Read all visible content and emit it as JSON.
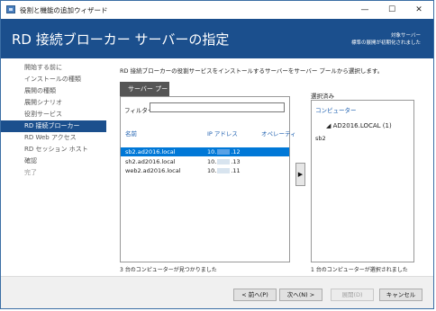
{
  "window": {
    "title": "役割と機能の追加ウィザード",
    "controls": {
      "minimize": "—",
      "maximize": "☐",
      "close": "✕"
    }
  },
  "header": {
    "title": "RD 接続ブローカー サーバーの指定",
    "destination_label": "対象サーバー",
    "destination_value": "標準の展開が初期化されました"
  },
  "nav": {
    "items": [
      {
        "label": "開始する前に",
        "state": "done"
      },
      {
        "label": "インストールの種類",
        "state": "done"
      },
      {
        "label": "展開の種類",
        "state": "done"
      },
      {
        "label": "展開シナリオ",
        "state": "done"
      },
      {
        "label": "役割サービス",
        "state": "done"
      },
      {
        "label": "RD 接続ブローカー",
        "state": "active"
      },
      {
        "label": "RD Web アクセス",
        "state": "done"
      },
      {
        "label": "RD セッション ホスト",
        "state": "done"
      },
      {
        "label": "確認",
        "state": "done"
      },
      {
        "label": "完了",
        "state": "future"
      }
    ]
  },
  "main": {
    "description": "RD 接続ブローカーの役割サービスをインストールするサーバーをサーバー プールから選択します。",
    "pool_tab": "サーバー プール",
    "filter_label": "フィルター:",
    "filter_value": "",
    "columns": {
      "name": "名前",
      "ip": "IP アドレス",
      "os": "オペレーティ"
    },
    "servers": [
      {
        "name": "sb2.ad2016.local",
        "ip_prefix": "10.",
        "ip_suffix": ".12",
        "selected": true
      },
      {
        "name": "sh2.ad2016.local",
        "ip_prefix": "10.",
        "ip_suffix": ".13",
        "selected": false
      },
      {
        "name": "web2.ad2016.local",
        "ip_prefix": "10.",
        "ip_suffix": ".11",
        "selected": false
      }
    ],
    "found_count": "3 台のコンピューターが見つかりました",
    "add_button": "▶",
    "selected_label": "選択済み",
    "selected_header": "コンピューター",
    "selected_group": "AD2016.LOCAL (1)",
    "selected_group_arrow": "◢",
    "selected_item": "sb2",
    "selected_count": "1 台のコンピューターが選択されました"
  },
  "footer": {
    "prev": "< 前へ(P)",
    "next": "次へ(N) >",
    "install": "展開(D)",
    "cancel": "キャンセル"
  },
  "colors": {
    "header_bg": "#1b4f8d",
    "selection": "#0078d7",
    "link": "#1b5eaf"
  }
}
